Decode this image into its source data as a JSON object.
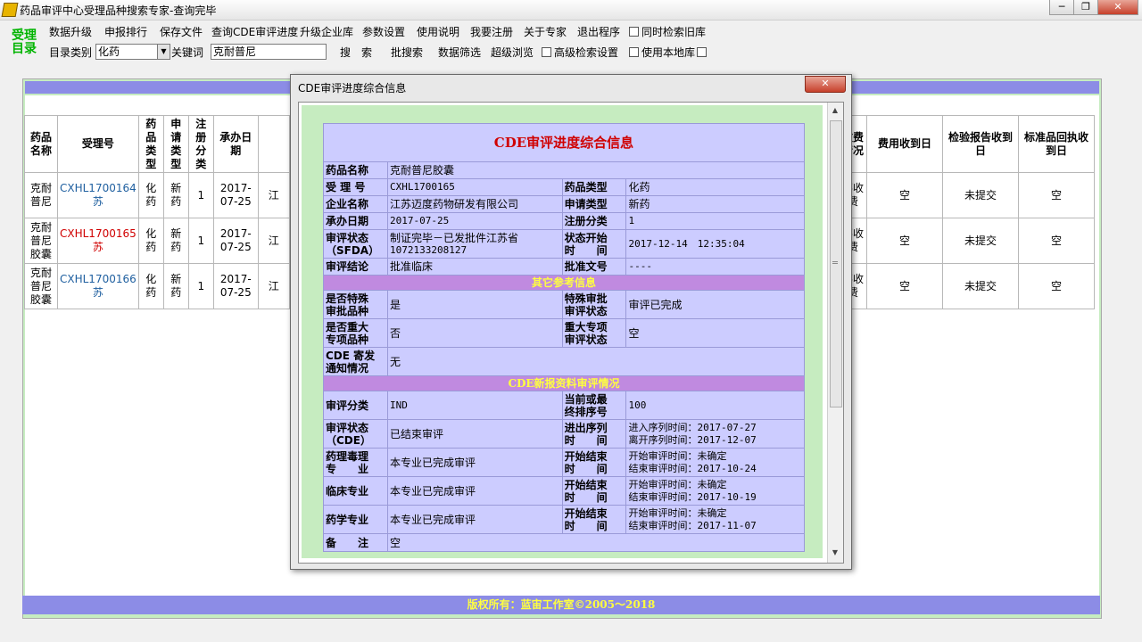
{
  "window": {
    "title": "药品审评中心受理品种搜索专家-查询完毕",
    "minimize": "─",
    "maximize": "❐",
    "close": "✕"
  },
  "logo": {
    "line1": "受理",
    "line2": "目录"
  },
  "menu": [
    "数据升级",
    "申报排行",
    "保存文件",
    "查询CDE审评进度",
    "升级企业库",
    "参数设置",
    "使用说明",
    "我要注册",
    "关于专家",
    "退出程序"
  ],
  "menu_checkbox": "同时检索旧库",
  "toolbar": {
    "category_label": "目录类别",
    "category_value": "化药",
    "keyword_label": "关键词",
    "keyword_value": "克耐普尼",
    "search": "搜　索",
    "batch": "批搜索",
    "filter": "数据筛选",
    "browse": "超级浏览",
    "advanced": "高级检索设置",
    "local": "使用本地库"
  },
  "main_table": {
    "left_headers": [
      "药品名称",
      "受理号",
      "药品类型",
      "申请类型",
      "注册分类",
      "承办日期"
    ],
    "right_headers": [
      "收费情况",
      "费用收到日",
      "检验报告收到日",
      "标准品回执收到日"
    ],
    "rows": [
      {
        "name": "克耐普尼",
        "id": "CXHL1700164苏",
        "drug": "化药",
        "apply": "新药",
        "cls": "1",
        "date": "2017-07-25",
        "cut": "江",
        "fee": "不收费",
        "fee_date": "空",
        "report": "未提交",
        "std": "空"
      },
      {
        "name": "克耐普尼胶囊",
        "id": "CXHL1700165苏",
        "drug": "化药",
        "apply": "新药",
        "cls": "1",
        "date": "2017-07-25",
        "cut": "江",
        "fee": "不收费",
        "fee_date": "空",
        "report": "未提交",
        "std": "空"
      },
      {
        "name": "克耐普尼胶囊",
        "id": "CXHL1700166苏",
        "drug": "化药",
        "apply": "新药",
        "cls": "1",
        "date": "2017-07-25",
        "cut": "江",
        "fee": "不收费",
        "fee_date": "空",
        "report": "未提交",
        "std": "空"
      }
    ]
  },
  "footer": "版权所有：蓝宙工作室©2005～2018",
  "dialog": {
    "title": "CDE审评进度综合信息",
    "close": "✕",
    "header": "CDE审评进度综合信息",
    "basic": {
      "name_k": "药品名称",
      "name_v": "克耐普尼胶囊",
      "id_k": "受 理 号",
      "id_v": "CXHL1700165",
      "drugtype_k": "药品类型",
      "drugtype_v": "化药",
      "corp_k": "企业名称",
      "corp_v": "江苏迈度药物研发有限公司",
      "applytype_k": "申请类型",
      "applytype_v": "新药",
      "date_k": "承办日期",
      "date_v": "2017-07-25",
      "regcls_k": "注册分类",
      "regcls_v": "1",
      "status_k1": "审评状态",
      "status_k2": "（SFDA）",
      "status_v1": "制证完毕－已发批件江苏省",
      "status_v2": "1072133208127",
      "stime_k1": "状态开始",
      "stime_k2": "时　　间",
      "stime_v": "2017-12-14　12:35:04",
      "concl_k": "审评结论",
      "concl_v": "批准临床",
      "approval_k": "批准文号",
      "approval_v": "----"
    },
    "other_title": "其它参考信息",
    "other": {
      "special_k1": "是否特殊",
      "special_k2": "审批品种",
      "special_v": "是",
      "special_state_k1": "特殊审批",
      "special_state_k2": "审评状态",
      "special_state_v": "审评已完成",
      "major_k1": "是否重大",
      "major_k2": "专项品种",
      "major_v": "否",
      "major_state_k1": "重大专项",
      "major_state_k2": "审评状态",
      "major_state_v": "空",
      "notice_k1": "CDE 寄发",
      "notice_k2": "通知情况",
      "notice_v": "无"
    },
    "new_title": "CDE新报资料审评情况",
    "review": {
      "cls_k": "审评分类",
      "cls_v": "IND",
      "order_k1": "当前或最",
      "order_k2": "终排序号",
      "order_v": "100",
      "state_k1": "审评状态",
      "state_k2": "（CDE）",
      "state_v": "已结束审评",
      "queue_k1": "进出序列",
      "queue_k2": "时　　间",
      "queue_v1": "进入序列时间：2017-07-27",
      "queue_v2": "离开序列时间：2017-12-07",
      "pharm_k1": "药理毒理",
      "pharm_k2": "专　　业",
      "pharm_v": "本专业已完成审评",
      "pharm_t_k1": "开始结束",
      "pharm_t_k2": "时　　间",
      "pharm_t_v1": "开始审评时间：未确定",
      "pharm_t_v2": "结束审评时间：2017-10-24",
      "clin_k": "临床专业",
      "clin_v": "本专业已完成审评",
      "clin_t_k1": "开始结束",
      "clin_t_k2": "时　　间",
      "clin_t_v1": "开始审评时间：未确定",
      "clin_t_v2": "结束审评时间：2017-10-19",
      "chem_k": "药学专业",
      "chem_v": "本专业已完成审评",
      "chem_t_k1": "开始结束",
      "chem_t_k2": "时　　间",
      "chem_t_v1": "开始审评时间：未确定",
      "chem_t_v2": "结束审评时间：2017-11-07",
      "note_k": "备　　注",
      "note_v": "空"
    }
  }
}
